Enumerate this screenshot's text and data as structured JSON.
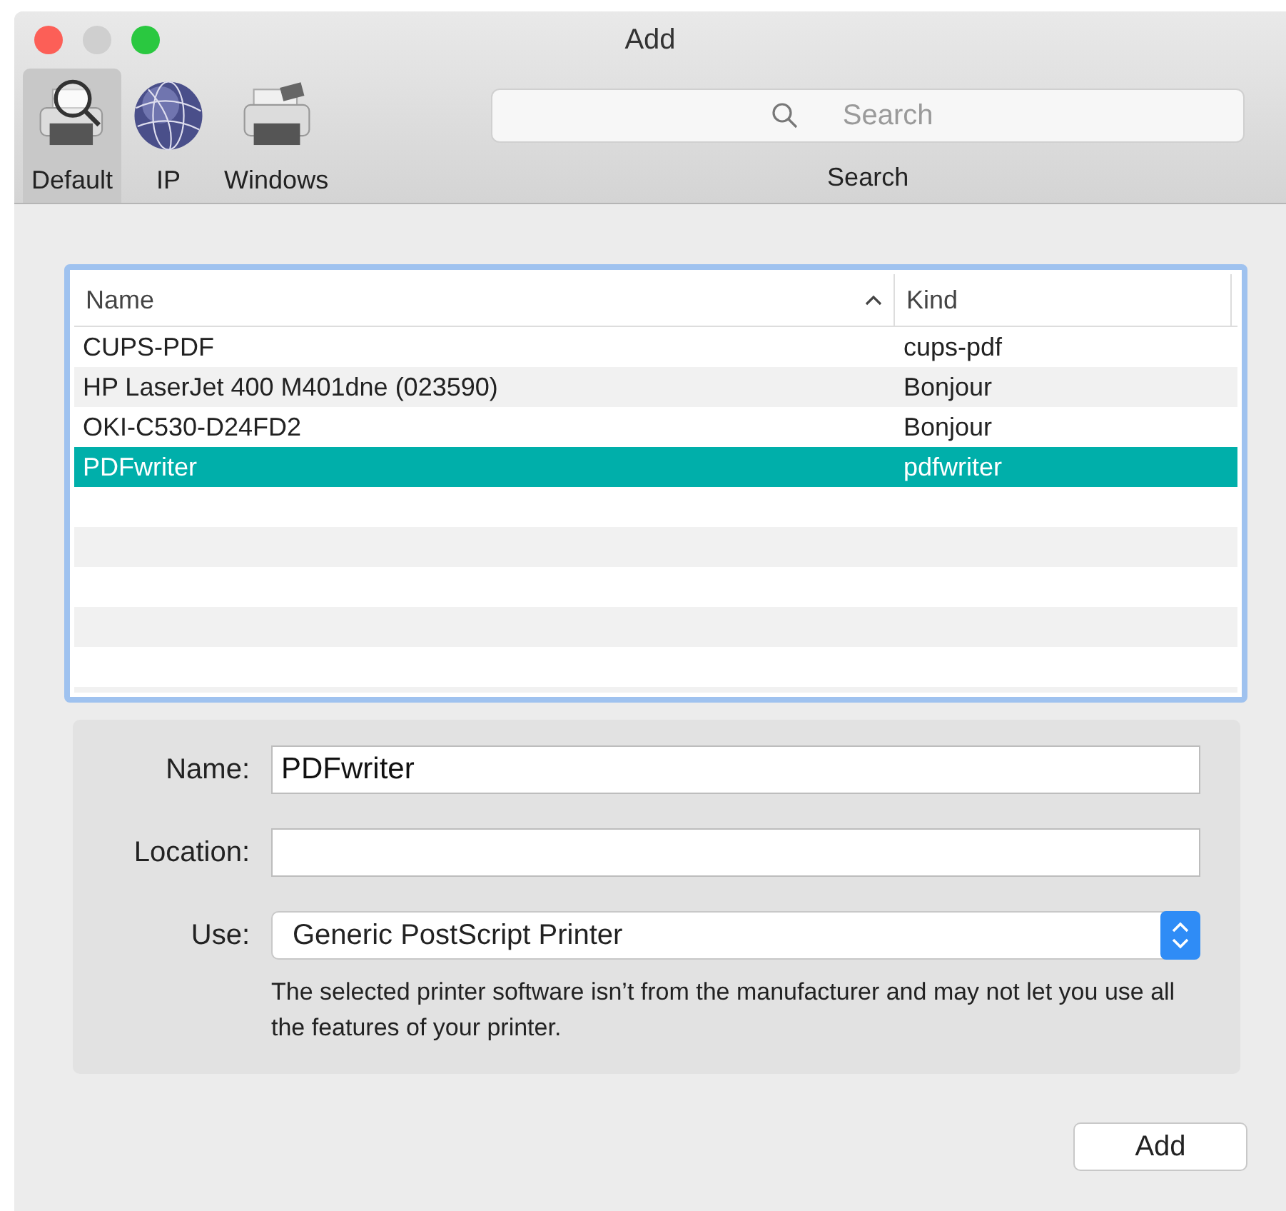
{
  "window": {
    "title": "Add"
  },
  "toolbar": {
    "tabs": [
      {
        "label": "Default",
        "kind": "magnifier",
        "selected": true
      },
      {
        "label": "IP",
        "kind": "globe",
        "selected": false
      },
      {
        "label": "Windows",
        "kind": "printer",
        "selected": false
      }
    ],
    "search": {
      "placeholder": "Search",
      "label": "Search"
    }
  },
  "table": {
    "columns": [
      {
        "label": "Name",
        "sorted": true
      },
      {
        "label": "Kind",
        "sorted": false
      }
    ],
    "rows": [
      {
        "name": "CUPS-PDF",
        "kind": "cups-pdf",
        "selected": false
      },
      {
        "name": "HP LaserJet 400 M401dne (023590)",
        "kind": "Bonjour",
        "selected": false
      },
      {
        "name": "OKI-C530-D24FD2",
        "kind": "Bonjour",
        "selected": false
      },
      {
        "name": "PDFwriter",
        "kind": "pdfwriter",
        "selected": true
      }
    ]
  },
  "form": {
    "name": {
      "label": "Name:",
      "value": "PDFwriter"
    },
    "location": {
      "label": "Location:"
    },
    "use": {
      "label": "Use:",
      "value": "Generic PostScript Printer"
    },
    "note": "The selected printer software isn’t from the manufacturer and may not let you use all the features of your printer."
  },
  "buttons": [
    "Add"
  ]
}
